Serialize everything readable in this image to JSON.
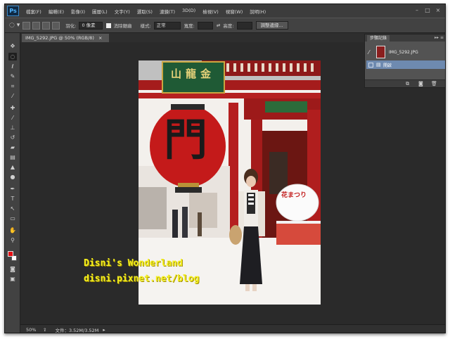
{
  "app": {
    "logo": "Ps"
  },
  "menubar": {
    "items": [
      "檔案(F)",
      "編輯(E)",
      "影像(I)",
      "圖層(L)",
      "文字(Y)",
      "選取(S)",
      "濾鏡(T)",
      "3D(D)",
      "檢視(V)",
      "視窗(W)",
      "說明(H)"
    ],
    "window_buttons": [
      "minimize-icon",
      "maximize-icon",
      "close-icon"
    ]
  },
  "options": {
    "feather_label": "羽化:",
    "feather_value": "0 像素",
    "antialias_label": "消除鋸齒",
    "style_label": "樣式:",
    "style_value": "正常",
    "width_label": "寬度:",
    "height_label": "高度:",
    "refine_button": "調整邊緣..."
  },
  "document": {
    "tab_label": "IMG_5292.JPG @ 50% (RGB/8)",
    "close_glyph": "×"
  },
  "photo": {
    "sign_text": "山龍金",
    "lantern_text": "門",
    "side_sign_text": "花まつり",
    "watermark_line1": "Disni's Wonderland",
    "watermark_line2": "disni.pixnet.net/blog"
  },
  "history_panel": {
    "tab_label": "步驟記錄",
    "snapshot_label": "IMG_5292.JPG",
    "state_label": "開啟",
    "controls": "▸▸ ≡"
  },
  "status": {
    "zoom": "50%",
    "doc_info": "文件：3.52M/3.52M",
    "arrow": "▸"
  },
  "colors": {
    "foreground": "#e60f14",
    "background": "#ffffff",
    "selection": "#6e8ab0"
  }
}
